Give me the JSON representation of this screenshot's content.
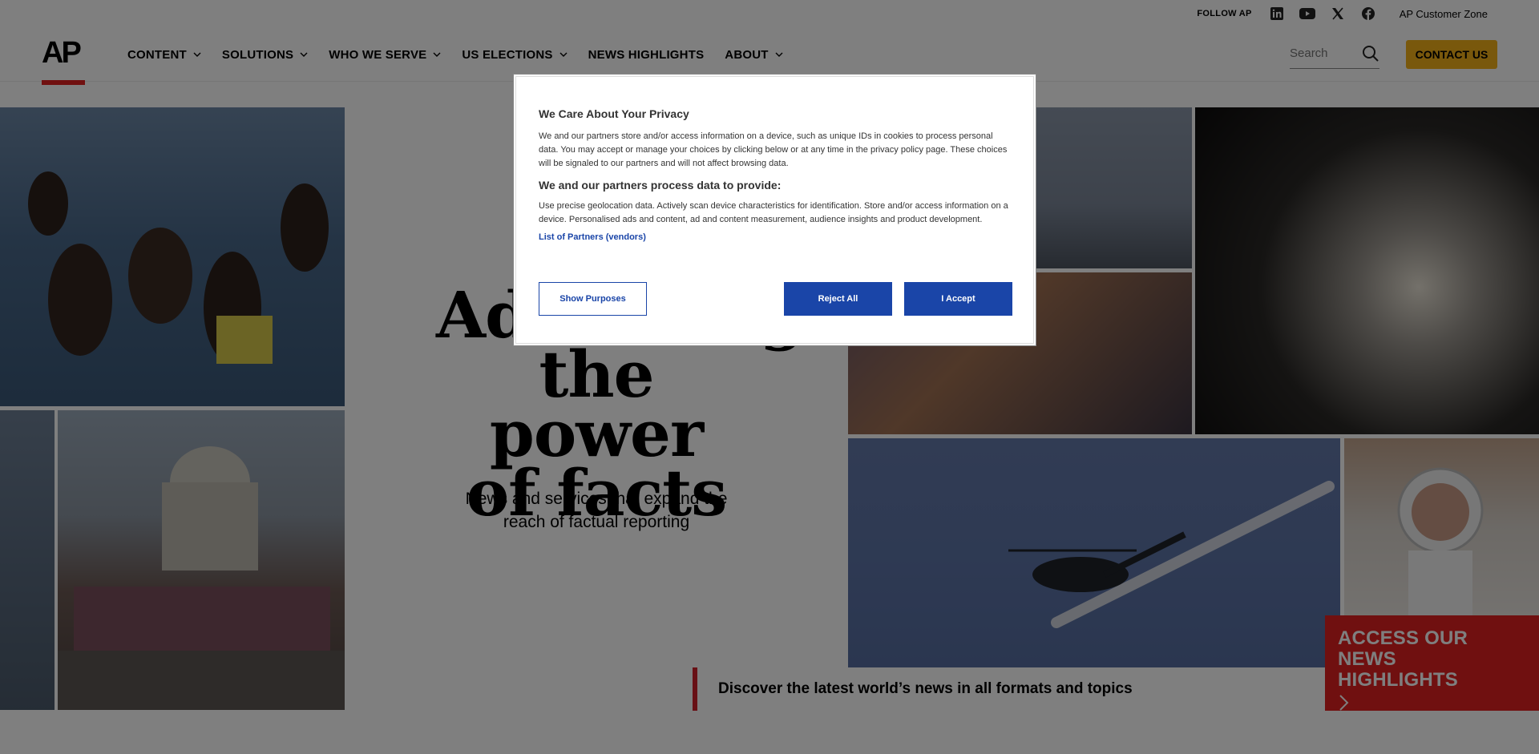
{
  "utility": {
    "follow_label": "FOLLOW AP",
    "social_icons": [
      "linkedin-icon",
      "youtube-icon",
      "x-icon",
      "facebook-icon"
    ],
    "customer_zone": "AP Customer Zone"
  },
  "header": {
    "logo": "AP",
    "nav": [
      {
        "label": "CONTENT",
        "has_dropdown": true
      },
      {
        "label": "SOLUTIONS",
        "has_dropdown": true
      },
      {
        "label": "WHO WE SERVE",
        "has_dropdown": true
      },
      {
        "label": "US ELECTIONS",
        "has_dropdown": true
      },
      {
        "label": "NEWS HIGHLIGHTS",
        "has_dropdown": false
      },
      {
        "label": "ABOUT",
        "has_dropdown": true
      }
    ],
    "search_placeholder": "Search",
    "contact_label": "CONTACT US",
    "accent_color": "#f2b119"
  },
  "hero": {
    "title_line1": "Advancing",
    "title_line2": "the power",
    "title_line3": "of facts",
    "subtitle": "News and services that expand the reach of factual reporting"
  },
  "discover": {
    "label": "Discover the latest world’s news in all formats and topics"
  },
  "access": {
    "label_line1": "ACCESS OUR NEWS",
    "label_line2": "HIGHLIGHTS",
    "color": "#e02020"
  },
  "consent": {
    "title": "We Care About Your Privacy",
    "body": "We and our partners store and/or access information on a device, such as unique IDs in cookies to process personal data. You may accept or manage your choices by clicking below or at any time in the privacy policy page. These choices will be signaled to our partners and will not affect browsing data.",
    "subtitle": "We and our partners process data to provide:",
    "purposes": "Use precise geolocation data. Actively scan device characteristics for identification. Store and/or access information on a device. Personalised ads and content, ad and content measurement, audience insights and product development.",
    "vendors_link": "List of Partners (vendors)",
    "show_purposes": "Show Purposes",
    "reject_all": "Reject All",
    "accept": "I Accept",
    "button_color": "#1a45a8"
  }
}
